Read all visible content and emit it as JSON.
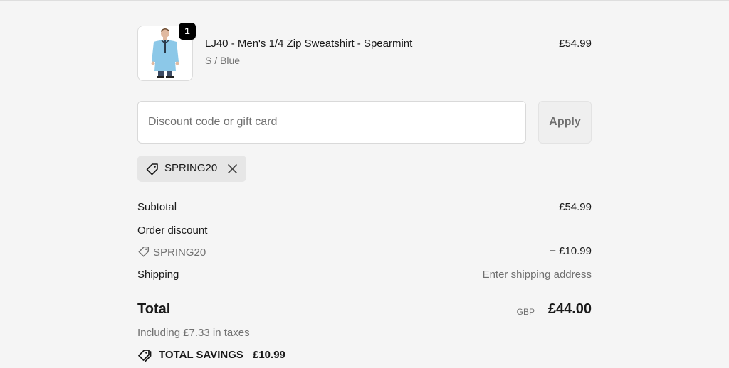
{
  "line_item": {
    "quantity": "1",
    "title": "LJ40 - Men's 1/4 Zip Sweatshirt - Spearmint",
    "variant": "S / Blue",
    "price": "£54.99"
  },
  "discount": {
    "placeholder": "Discount code or gift card",
    "value": "",
    "apply_label": "Apply",
    "applied_code": "SPRING20"
  },
  "summary": {
    "subtotal_label": "Subtotal",
    "subtotal_value": "£54.99",
    "order_discount_label": "Order discount",
    "discount_code": "SPRING20",
    "discount_value": "− £10.99",
    "shipping_label": "Shipping",
    "shipping_value": "Enter shipping address",
    "total_label": "Total",
    "currency": "GBP",
    "total_value": "£44.00",
    "taxes_text": "Including £7.33 in taxes",
    "savings_label": "TOTAL SAVINGS",
    "savings_value": "£10.99"
  },
  "icons": {
    "tag": "tag-icon",
    "close": "close-icon",
    "savings": "savings-tag-icon"
  },
  "colors": {
    "background": "#f5f5f5",
    "muted_text": "#707070",
    "chip_background": "#e6e6e6",
    "badge": "#000000"
  }
}
